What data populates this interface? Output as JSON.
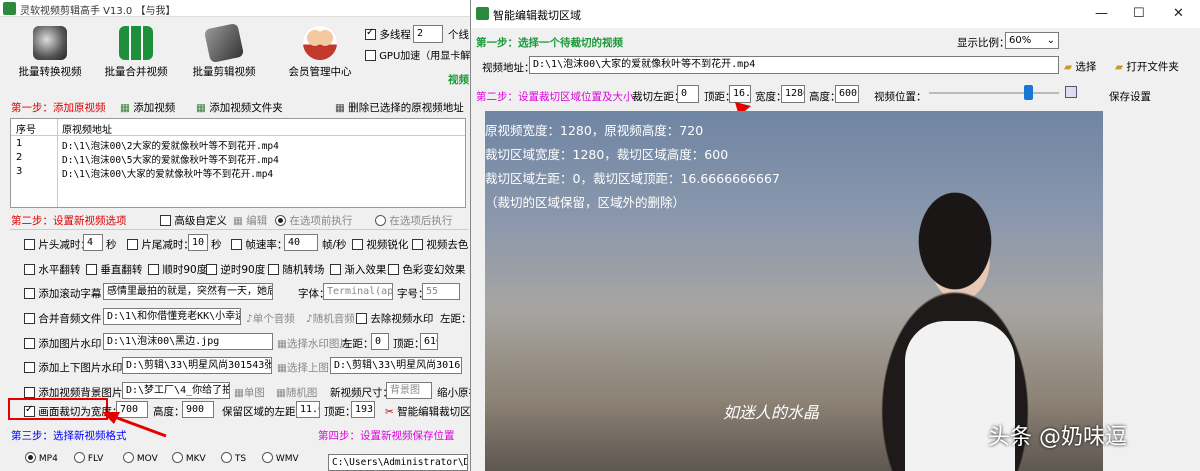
{
  "main_window": {
    "title": "灵软视频剪辑高手 V13.0 【与我】",
    "toolbar": [
      {
        "label": "批量转换视频"
      },
      {
        "label": "批量合并视频"
      },
      {
        "label": "批量剪辑视频"
      },
      {
        "label": "会员管理中心"
      }
    ],
    "multithread_label": "多线程",
    "multithread_value": "2",
    "thread_suffix": "个线",
    "gpu_label": "GPU加速（用显卡解码）",
    "video_label": "视频",
    "step1": {
      "title": "第一步：添加原视频",
      "add_video": "添加视频",
      "add_folder": "添加视频文件夹",
      "delete_selected": "删除已选择的原视频地址"
    },
    "file_list": {
      "headers": [
        "序号",
        "原视频地址"
      ],
      "rows": [
        [
          "1",
          "D:\\1\\泡沫00\\2大家的爱就像秋叶等不到花开.mp4"
        ],
        [
          "2",
          "D:\\1\\泡沫00\\5大家的爱就像秋叶等不到花开.mp4"
        ],
        [
          "3",
          "D:\\1\\泡沫00\\大家的爱就像秋叶等不到花开.mp4"
        ]
      ]
    },
    "step2": {
      "title": "第二步：设置新视频选项",
      "advanced": "高级自定义",
      "edit": "编辑",
      "before": "在选项前执行",
      "after": "在选项后执行"
    },
    "row1": {
      "head_trim": "片头减时：",
      "head_val": "4",
      "sec": "秒",
      "tail_trim": "片尾减时：",
      "tail_val": "10",
      "sec2": "秒",
      "framerate": "帧速率：",
      "framerate_val": "40",
      "fps": "帧/秒",
      "sharpen": "视频锐化",
      "decolor": "视频去色"
    },
    "row2": {
      "hflip": "水平翻转",
      "vflip": "垂直翻转",
      "cw90": "顺时90度",
      "ccw90": "逆时90度",
      "random_trans": "随机转场",
      "fade_in": "渐入效果",
      "color_shift": "色彩变幻效果"
    },
    "row3": {
      "scroll_caption": "添加滚动字幕：",
      "caption_text": "感情里最拍的就是，突然有一天，她后悔",
      "font_label": "字体：",
      "font_value": "Terminal(ap",
      "size_label": "字号：",
      "size_value": "55"
    },
    "row4": {
      "merge_audio": "合并音频文件：",
      "audio_path": "D:\\1\\和你借懂竞老KK\\小幸运.mp",
      "single_audio": "单个音频",
      "random_audio": "随机音频",
      "remove_watermark": "去除视频水印",
      "left": "左距："
    },
    "row5": {
      "add_image_wm": "添加图片水印：",
      "wm_path": "D:\\1\\泡沫00\\黑边.jpg",
      "choose_wm": "选择水印图片",
      "left": "左距：",
      "left_val": "0",
      "top": "顶距：",
      "top_val": "616"
    },
    "row6": {
      "add_tb_image": "添加上下图片水印：",
      "top_path": "D:\\剪辑\\33\\明星风尚301543张艺",
      "choose_top": "选择上图",
      "bottom_path": "D:\\剪辑\\33\\明星风尚301682张艺"
    },
    "row7": {
      "add_bg": "添加视频背景图片：",
      "bg_path": "D:\\梦工厂\\4_你给了拍适",
      "single": "单图",
      "random": "随机图",
      "new_size": "新视频尺寸：",
      "size_value": "背景图",
      "shrink": "缩小原视"
    },
    "row8": {
      "crop_width": "画面裁切为宽度：",
      "width_val": "700",
      "height": "高度：",
      "height_val": "900",
      "keep_left": "保留区域的左距：",
      "keep_left_val": "11.66",
      "top": "顶距：",
      "top_val": "193.3",
      "smart_crop": "智能编辑裁切区域"
    },
    "step3": {
      "title": "第三步：选择新视频格式",
      "formats": [
        "MP4",
        "FLV",
        "MOV",
        "MKV",
        "TS",
        "WMV"
      ]
    },
    "step4": {
      "title": "第四步：设置新视频保存位置",
      "path": "C:\\Users\\Administrator\\Desktop"
    }
  },
  "crop_window": {
    "title": "智能编辑裁切区域",
    "step1": "第一步：选择一个待裁切的视频",
    "display_ratio_label": "显示比例：",
    "display_ratio_value": "60%",
    "video_addr_label": "视频地址：",
    "video_addr": "D:\\1\\泡沫00\\大家的爱就像秋叶等不到花开.mp4",
    "select": "选择",
    "open_folder": "打开文件夹",
    "step2": "第二步：设置裁切区域位置及大小",
    "left_label": "裁切左距：",
    "left_val": "0",
    "top_label": "顶距：",
    "top_val": "16.66",
    "width_label": "宽度：",
    "width_val": "1280",
    "height_label": "高度：",
    "height_val": "600",
    "position_label": "视频位置：",
    "position_fraction": 0.76,
    "save": "保存设置",
    "overlay": [
      "原视频宽度：1280，原视频高度：720",
      "裁切区域宽度：1280，裁切区域高度：600",
      "裁切区域左距：0，裁切区域顶距：16.6666666667",
      "（裁切的区域保留，区域外的删除）"
    ],
    "subtitle": "如迷人的水晶"
  },
  "watermark": "头条 @奶味逗",
  "colors": {
    "step_red": "#e00000",
    "step_blue": "#0000ff",
    "step_magenta": "#e000e0",
    "arrow_red": "#e60000"
  }
}
